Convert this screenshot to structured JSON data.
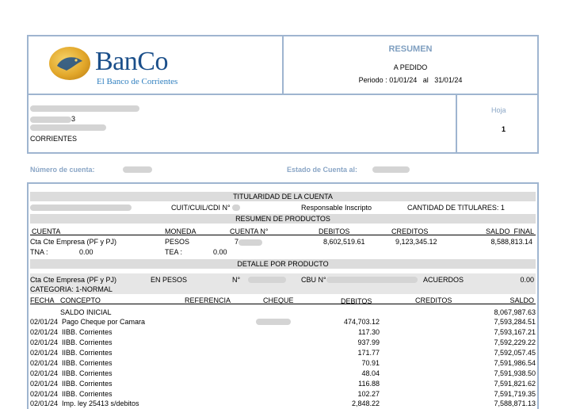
{
  "bank": {
    "logo_name": "BanCo",
    "logo_tagline": "El Banco de Corrientes"
  },
  "header": {
    "title": "RESUMEN",
    "subtitle": "A PEDIDO",
    "period_label": "Periodo :",
    "period_from": "01/01/24",
    "period_sep": "al",
    "period_to": "31/01/24"
  },
  "client": {
    "address_suffix": "3",
    "province": "CORRIENTES",
    "page_label": "Hoja",
    "page_number": "1"
  },
  "account_info": {
    "account_number_label": "Número de cuenta:",
    "statement_label": "Estado de Cuenta al:"
  },
  "titularidad": {
    "section_title": "TITULARIDAD DE LA CUENTA",
    "cuit_label": "CUIT/CUIL/CDI N°",
    "tax_status": "Responsable Inscripto",
    "holders_label": "CANTIDAD DE TITULARES:",
    "holders_count": "1"
  },
  "resumen_productos": {
    "section_title": "RESUMEN DE PRODUCTOS",
    "columns": [
      "CUENTA",
      "MONEDA",
      "CUENTA N°",
      "DEBITOS",
      "CREDITOS",
      "SALDO  FINAL"
    ],
    "account_type": "Cta Cte Empresa (PF y PJ)",
    "currency": "PESOS",
    "account_no_visible": "7",
    "debits": "8,602,519.61",
    "credits": "9,123,345.12",
    "final_balance": "8,588,813.14",
    "tna_label": "TNA :",
    "tna_value": "0.00",
    "tea_label": "TEA :",
    "tea_value": "0.00"
  },
  "detalle": {
    "section_title": "DETALLE POR PRODUCTO",
    "account_type": "Cta Cte Empresa (PF y PJ)",
    "currency_label": "EN PESOS",
    "number_label": "N°",
    "cbu_label": "CBU N°",
    "agreements_label": "ACUERDOS",
    "agreements_value": "0.00",
    "category": "CATEGORIA: 1-NORMAL",
    "columns": {
      "fecha": "FECHA",
      "concepto": "CONCEPTO",
      "referencia": "REFERENCIA",
      "cheque": "CHEQUE",
      "debitos": "DEBITOS",
      "creditos": "CREDITOS",
      "saldo": "SALDO"
    },
    "opening_label": "SALDO INICIAL",
    "opening_balance": "8,067,987.63",
    "rows": [
      {
        "fecha": "02/01/24",
        "concepto": "Pago Cheque por Camara",
        "debito": "474,703.12",
        "saldo": "7,593,284.51"
      },
      {
        "fecha": "02/01/24",
        "concepto": "IIBB. Corrientes",
        "debito": "117.30",
        "saldo": "7,593,167.21"
      },
      {
        "fecha": "02/01/24",
        "concepto": "IIBB. Corrientes",
        "debito": "937.99",
        "saldo": "7,592,229.22"
      },
      {
        "fecha": "02/01/24",
        "concepto": "IIBB. Corrientes",
        "debito": "171.77",
        "saldo": "7,592,057.45"
      },
      {
        "fecha": "02/01/24",
        "concepto": "IIBB. Corrientes",
        "debito": "70.91",
        "saldo": "7,591,986.54"
      },
      {
        "fecha": "02/01/24",
        "concepto": "IIBB. Corrientes",
        "debito": "48.04",
        "saldo": "7,591,938.50"
      },
      {
        "fecha": "02/01/24",
        "concepto": "IIBB. Corrientes",
        "debito": "116.88",
        "saldo": "7,591,821.62"
      },
      {
        "fecha": "02/01/24",
        "concepto": "IIBB. Corrientes",
        "debito": "102.27",
        "saldo": "7,591,719.35"
      },
      {
        "fecha": "02/01/24",
        "concepto": "Imp. ley 25413 s/debitos",
        "debito": "2,848.22",
        "saldo": "7,588,871.13"
      }
    ]
  }
}
